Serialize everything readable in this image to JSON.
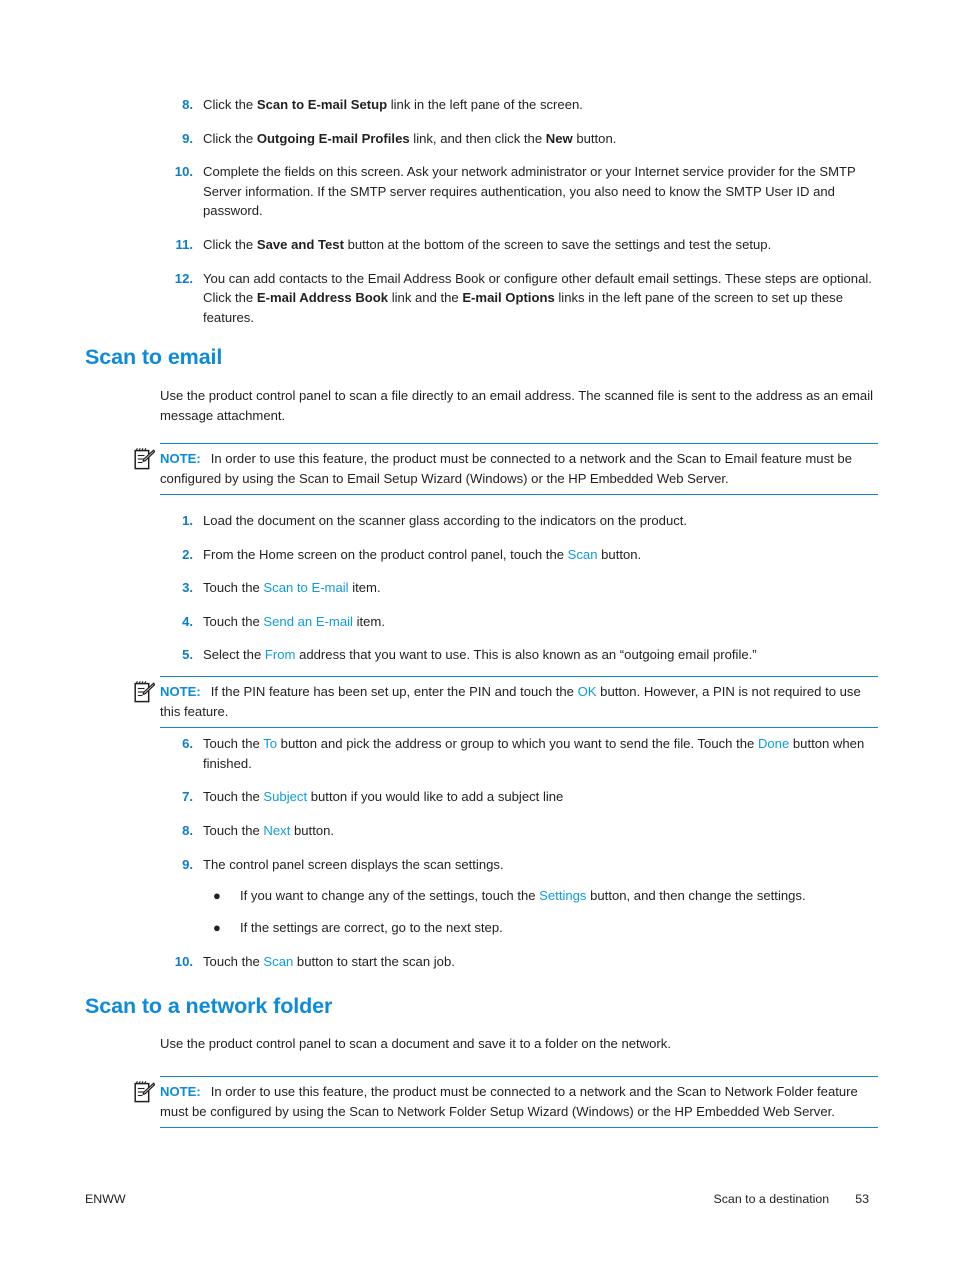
{
  "page": {
    "footer_left": "ENWW",
    "footer_chapter": "Scan to a destination",
    "footer_page_number": "53"
  },
  "colors": {
    "heading_blue": "#0d8bd9",
    "number_blue": "#0b7ec4",
    "link_blue": "#0d9ddb",
    "rule_blue": "#1186c9",
    "body_text": "#231f20"
  },
  "top_steps": {
    "items": [
      {
        "number": "8.",
        "parts": [
          {
            "t": "Click the ",
            "s": "plain"
          },
          {
            "t": "Scan to E-mail Setup",
            "s": "bold"
          },
          {
            "t": " link in the left pane of the screen.",
            "s": "plain"
          }
        ]
      },
      {
        "number": "9.",
        "parts": [
          {
            "t": "Click the ",
            "s": "plain"
          },
          {
            "t": "Outgoing E-mail Profiles",
            "s": "bold"
          },
          {
            "t": " link, and then click the ",
            "s": "plain"
          },
          {
            "t": "New",
            "s": "bold"
          },
          {
            "t": " button.",
            "s": "plain"
          }
        ]
      },
      {
        "number": "10.",
        "parts": [
          {
            "t": "Complete the fields on this screen. Ask your network administrator or your Internet service provider for the SMTP Server information. If the SMTP server requires authentication, you also need to know the SMTP User ID and password.",
            "s": "plain"
          }
        ]
      },
      {
        "number": "11.",
        "parts": [
          {
            "t": "Click the ",
            "s": "plain"
          },
          {
            "t": "Save and Test",
            "s": "bold"
          },
          {
            "t": " button at the bottom of the screen to save the settings and test the setup.",
            "s": "plain"
          }
        ]
      },
      {
        "number": "12.",
        "parts": [
          {
            "t": "You can add contacts to the Email Address Book or configure other default email settings. These steps are optional. Click the ",
            "s": "plain"
          },
          {
            "t": "E-mail Address Book",
            "s": "bold"
          },
          {
            "t": " link and the ",
            "s": "plain"
          },
          {
            "t": "E-mail Options",
            "s": "bold"
          },
          {
            "t": " links in the left pane of the screen to set up these features.",
            "s": "plain"
          }
        ]
      }
    ]
  },
  "scan_to_email": {
    "heading": "Scan to email",
    "intro": "Use the product control panel to scan a file directly to an email address. The scanned file is sent to the address as an email message attachment.",
    "note": {
      "label": "NOTE:",
      "icon": "note-pencil-icon",
      "parts": [
        {
          "t": "In order to use this feature, the product must be connected to a network and the Scan to Email feature must be configured by using the Scan to Email Setup Wizard (Windows) or the HP Embedded Web Server.",
          "s": "plain"
        }
      ]
    },
    "steps_part1": [
      {
        "number": "1.",
        "parts": [
          {
            "t": "Load the document on the scanner glass according to the indicators on the product.",
            "s": "plain"
          }
        ]
      },
      {
        "number": "2.",
        "parts": [
          {
            "t": "From the Home screen on the product control panel, touch the ",
            "s": "plain"
          },
          {
            "t": "Scan",
            "s": "link"
          },
          {
            "t": " button.",
            "s": "plain"
          }
        ]
      },
      {
        "number": "3.",
        "parts": [
          {
            "t": "Touch the ",
            "s": "plain"
          },
          {
            "t": "Scan to E-mail",
            "s": "link"
          },
          {
            "t": " item.",
            "s": "plain"
          }
        ]
      },
      {
        "number": "4.",
        "parts": [
          {
            "t": "Touch the ",
            "s": "plain"
          },
          {
            "t": "Send an E-mail",
            "s": "link"
          },
          {
            "t": " item.",
            "s": "plain"
          }
        ]
      },
      {
        "number": "5.",
        "parts": [
          {
            "t": "Select the ",
            "s": "plain"
          },
          {
            "t": "From",
            "s": "link"
          },
          {
            "t": " address that you want to use. This is also known as an “outgoing email profile.”",
            "s": "plain"
          }
        ]
      }
    ],
    "pin_note": {
      "label": "NOTE:",
      "icon": "note-pencil-icon",
      "parts": [
        {
          "t": "If the PIN feature has been set up, enter the PIN and touch the ",
          "s": "plain"
        },
        {
          "t": "OK",
          "s": "link"
        },
        {
          "t": " button. However, a PIN is not required to use this feature.",
          "s": "plain"
        }
      ]
    },
    "steps_part2": [
      {
        "number": "6.",
        "parts": [
          {
            "t": "Touch the ",
            "s": "plain"
          },
          {
            "t": "To",
            "s": "link"
          },
          {
            "t": " button and pick the address or group to which you want to send the file. Touch the ",
            "s": "plain"
          },
          {
            "t": "Done",
            "s": "link"
          },
          {
            "t": " button when finished.",
            "s": "plain"
          }
        ]
      },
      {
        "number": "7.",
        "parts": [
          {
            "t": "Touch the ",
            "s": "plain"
          },
          {
            "t": "Subject",
            "s": "link"
          },
          {
            "t": " button if you would like to add a subject line",
            "s": "plain"
          }
        ]
      },
      {
        "number": "8.",
        "parts": [
          {
            "t": "Touch the ",
            "s": "plain"
          },
          {
            "t": "Next",
            "s": "link"
          },
          {
            "t": " button.",
            "s": "plain"
          }
        ]
      }
    ],
    "step9": {
      "number": "9.",
      "parts": [
        {
          "t": "The control panel screen displays the scan settings.",
          "s": "plain"
        }
      ],
      "bullets": [
        {
          "parts": [
            {
              "t": "If you want to change any of the settings, touch the ",
              "s": "plain"
            },
            {
              "t": "Settings",
              "s": "link"
            },
            {
              "t": " button, and then change the settings.",
              "s": "plain"
            }
          ]
        },
        {
          "parts": [
            {
              "t": "If the settings are correct, go to the next step.",
              "s": "plain"
            }
          ]
        }
      ]
    },
    "step10": {
      "number": "10.",
      "parts": [
        {
          "t": "Touch the ",
          "s": "plain"
        },
        {
          "t": "Scan",
          "s": "link"
        },
        {
          "t": " button to start the scan job.",
          "s": "plain"
        }
      ]
    }
  },
  "scan_to_network_folder": {
    "heading": "Scan to a network folder",
    "intro": "Use the product control panel to scan a document and save it to a folder on the network.",
    "note": {
      "label": "NOTE:",
      "icon": "note-pencil-icon",
      "parts": [
        {
          "t": "In order to use this feature, the product must be connected to a network and the Scan to Network Folder feature must be configured by using the Scan to Network Folder Setup Wizard (Windows) or the HP Embedded Web Server.",
          "s": "plain"
        }
      ]
    }
  }
}
